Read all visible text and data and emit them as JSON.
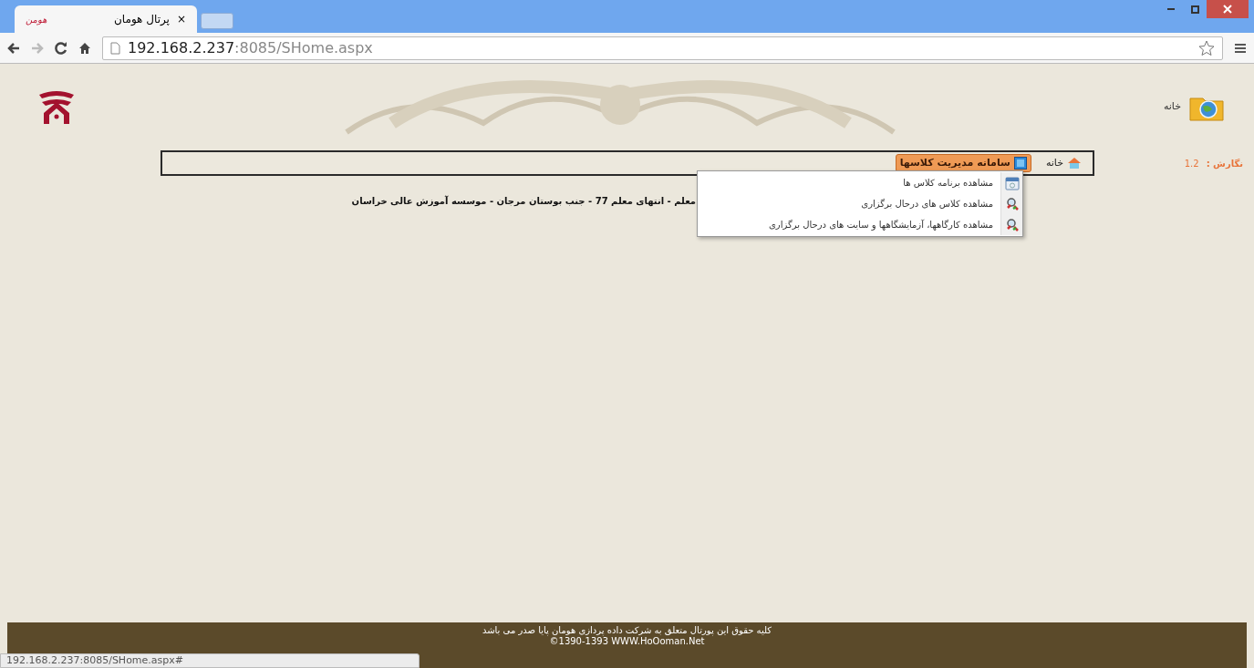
{
  "browser": {
    "tab_favicon": "هومن",
    "tabs": [
      {
        "title": "پرتال هومان",
        "close": "×",
        "selected": true
      }
    ],
    "url_host": "192.168.2.237",
    "url_rest": ":8085/SHome.aspx",
    "status_url": "192.168.2.237:8085/SHome.aspx#"
  },
  "header": {
    "home_label": "خانه"
  },
  "version": {
    "label": "نگارش :",
    "value": "1.2"
  },
  "nav": {
    "items": [
      {
        "label": "خانه",
        "kind": "home",
        "selected": false
      },
      {
        "label": "سامانه مدیریت کلاسها",
        "kind": "menu",
        "selected": true
      }
    ]
  },
  "dropdown": {
    "items": [
      {
        "label": "مشاهده برنامه کلاس ها",
        "kind": "calendar"
      },
      {
        "label": "مشاهده کلاس های درحال برگزاری",
        "kind": "search"
      },
      {
        "label": "مشاهده کارگاهها، آزمایشگاهها و سایت های درحال برگزاری",
        "kind": "search"
      }
    ]
  },
  "address": "معلم - انتهای معلم 77 - جنب بوستان مرجان - موسسه آموزش عالی خراسان",
  "footer": {
    "lines": [
      "کلیه حقوق این پورتال متعلق به شرکت داده پردازی هومان پایا صدر می باشد",
      "©1390-1393   WWW.HoOoman.Net"
    ]
  }
}
